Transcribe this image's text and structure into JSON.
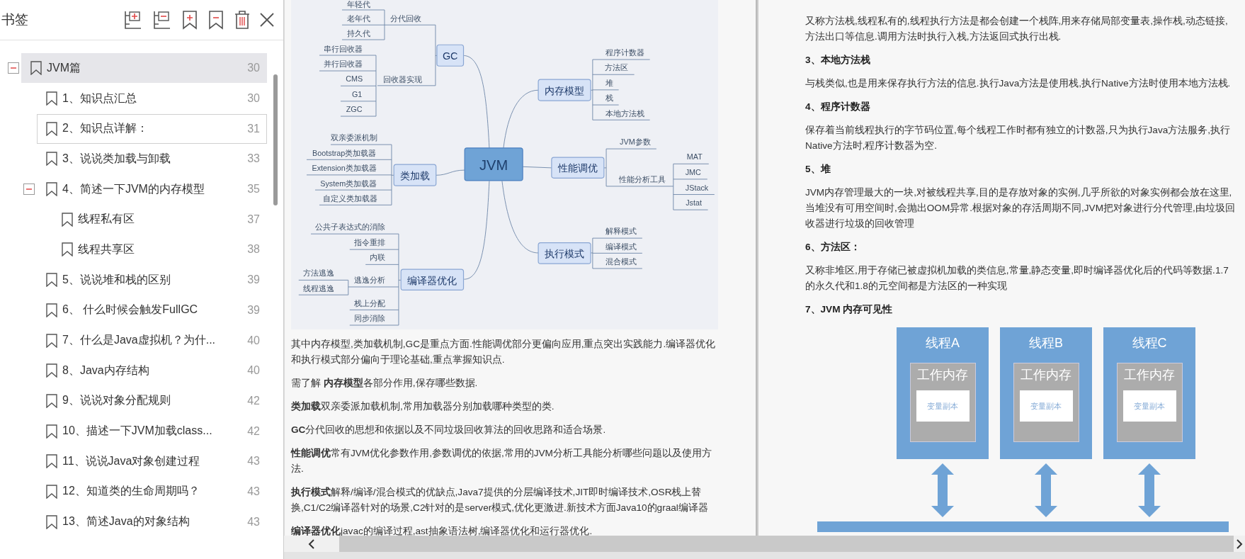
{
  "sidebar": {
    "title": "书签",
    "items": [
      {
        "label": "JVM篇",
        "page": "30",
        "selected": true,
        "focused": false,
        "expanded": true,
        "children": [
          {
            "label": "1、知识点汇总",
            "page": "30",
            "selected": false,
            "focused": false
          },
          {
            "label": "2、知识点详解：",
            "page": "31",
            "selected": false,
            "focused": true
          },
          {
            "label": "3、说说类加载与卸载",
            "page": "33",
            "selected": false,
            "focused": false
          },
          {
            "label": "4、简述一下JVM的内存模型",
            "page": "35",
            "selected": false,
            "focused": false,
            "expanded": true,
            "children": [
              {
                "label": "线程私有区",
                "page": "37",
                "selected": false,
                "focused": false
              },
              {
                "label": "线程共享区",
                "page": "38",
                "selected": false,
                "focused": false
              }
            ]
          },
          {
            "label": "5、说说堆和栈的区别",
            "page": "39",
            "selected": false,
            "focused": false
          },
          {
            "label": "6、 什么时候会触发FullGC",
            "page": "39",
            "selected": false,
            "focused": false
          },
          {
            "label": "7、什么是Java虚拟机？为什...",
            "page": "40",
            "selected": false,
            "focused": false
          },
          {
            "label": "8、Java内存结构",
            "page": "40",
            "selected": false,
            "focused": false
          },
          {
            "label": "9、说说对象分配规则",
            "page": "42",
            "selected": false,
            "focused": false
          },
          {
            "label": "10、描述一下JVM加载class...",
            "page": "42",
            "selected": false,
            "focused": false
          },
          {
            "label": "11、说说Java对象创建过程",
            "page": "43",
            "selected": false,
            "focused": false
          },
          {
            "label": "12、知道类的生命周期吗？",
            "page": "43",
            "selected": false,
            "focused": false
          },
          {
            "label": "13、简述Java的对象结构",
            "page": "43",
            "selected": false,
            "focused": false
          }
        ]
      }
    ]
  },
  "left_page": {
    "mind_map": {
      "root": "JVM",
      "branches": [
        {
          "label": "GC",
          "children": [
            {
              "label": "分代回收",
              "children": [
                {
                  "label": "年轻代"
                },
                {
                  "label": "老年代"
                },
                {
                  "label": "持久代"
                }
              ]
            },
            {
              "label": "回收器实现",
              "children": [
                {
                  "label": "串行回收器"
                },
                {
                  "label": "并行回收器"
                },
                {
                  "label": "CMS"
                },
                {
                  "label": "G1"
                },
                {
                  "label": "ZGC"
                }
              ]
            }
          ]
        },
        {
          "label": "类加载",
          "children": [
            {
              "label": "双亲委派机制"
            },
            {
              "label": "Bootstrap类加载器"
            },
            {
              "label": "Extension类加载器"
            },
            {
              "label": "System类加载器"
            },
            {
              "label": "自定义类加载器"
            }
          ]
        },
        {
          "label": "编译器优化",
          "children": [
            {
              "label": "公共子表达式的消除"
            },
            {
              "label": "指令重排"
            },
            {
              "label": "内联"
            },
            {
              "label": "逃逸分析",
              "children": [
                {
                  "label": "方法逃逸"
                },
                {
                  "label": "线程逃逸"
                }
              ]
            },
            {
              "label": "栈上分配"
            },
            {
              "label": "同步消除"
            }
          ]
        },
        {
          "label": "内存模型",
          "children": [
            {
              "label": "程序计数器"
            },
            {
              "label": "方法区"
            },
            {
              "label": "堆"
            },
            {
              "label": "栈"
            },
            {
              "label": "本地方法栈"
            }
          ]
        },
        {
          "label": "性能调优",
          "children": [
            {
              "label": "JVM参数"
            },
            {
              "label": "性能分析工具",
              "children": [
                {
                  "label": "MAT"
                },
                {
                  "label": "JMC"
                },
                {
                  "label": "JStack"
                },
                {
                  "label": "Jstat"
                }
              ]
            }
          ]
        },
        {
          "label": "执行模式",
          "children": [
            {
              "label": "解释模式"
            },
            {
              "label": "编译模式"
            },
            {
              "label": "混合模式"
            }
          ]
        }
      ]
    },
    "paragraphs": [
      "其中内存模型,类加载机制,GC是重点方面.性能调优部分更偏向应用,重点突出实践能力.编译器优化和执行模式部分偏向于理论基础,重点掌握知识点.",
      "需了解 **内存模型**各部分作用,保存哪些数据.",
      "**类加载**双亲委派加载机制,常用加载器分别加载哪种类型的类.",
      "**GC**分代回收的思想和依据以及不同垃圾回收算法的回收思路和适合场景.",
      "**性能调优**常有JVM优化参数作用,参数调优的依据,常用的JVM分析工具能分析哪些问题以及使用方法.",
      "**执行模式**解释/编译/混合模式的优缺点,Java7提供的分层编译技术,JIT即时编译技术,OSR栈上替换,C1/C2编译器针对的场景,C2针对的是server模式,优化更激进.新技术方面Java10的graal编译器",
      "**编译器优化**javac的编译过程,ast抽象语法树,编译器优化和运行器优化."
    ]
  },
  "right_page": {
    "blocks": [
      {
        "kind": "paragraph",
        "text": "又称方法栈,线程私有的,线程执行方法是都会创建一个栈阵,用来存储局部变量表,操作栈,动态链接,方法出口等信息.调用方法时执行入栈,方法返回式执行出栈."
      },
      {
        "kind": "heading",
        "text": "3、本地方法栈"
      },
      {
        "kind": "paragraph",
        "text": "与栈类似,也是用来保存执行方法的信息.执行Java方法是使用栈,执行Native方法时使用本地方法栈."
      },
      {
        "kind": "heading",
        "text": "4、程序计数器"
      },
      {
        "kind": "paragraph",
        "text": "保存着当前线程执行的字节码位置,每个线程工作时都有独立的计数器,只为执行Java方法服务,执行Native方法时,程序计数器为空."
      },
      {
        "kind": "heading",
        "text": "5、堆"
      },
      {
        "kind": "paragraph",
        "text": "JVM内存管理最大的一块,对被线程共享,目的是存放对象的实例,几乎所欲的对象实例都会放在这里,当堆没有可用空间时,会抛出OOM异常.根据对象的存活周期不同,JVM把对象进行分代管理,由垃圾回收器进行垃圾的回收管理"
      },
      {
        "kind": "heading",
        "text": "6、方法区："
      },
      {
        "kind": "paragraph",
        "text": "又称非堆区,用于存储已被虚拟机加载的类信息,常量,静态变量,即时编译器优化后的代码等数据.1.7的永久代和1.8的元空间都是方法区的一种实现"
      },
      {
        "kind": "heading",
        "text": "7、JVM 内存可见性"
      }
    ],
    "memory_diagram": {
      "threads": [
        {
          "title": "线程A",
          "memory": "工作内存",
          "copy": "变量副本"
        },
        {
          "title": "线程B",
          "memory": "工作内存",
          "copy": "变量副本"
        },
        {
          "title": "线程C",
          "memory": "工作内存",
          "copy": "变量副本"
        }
      ]
    }
  }
}
